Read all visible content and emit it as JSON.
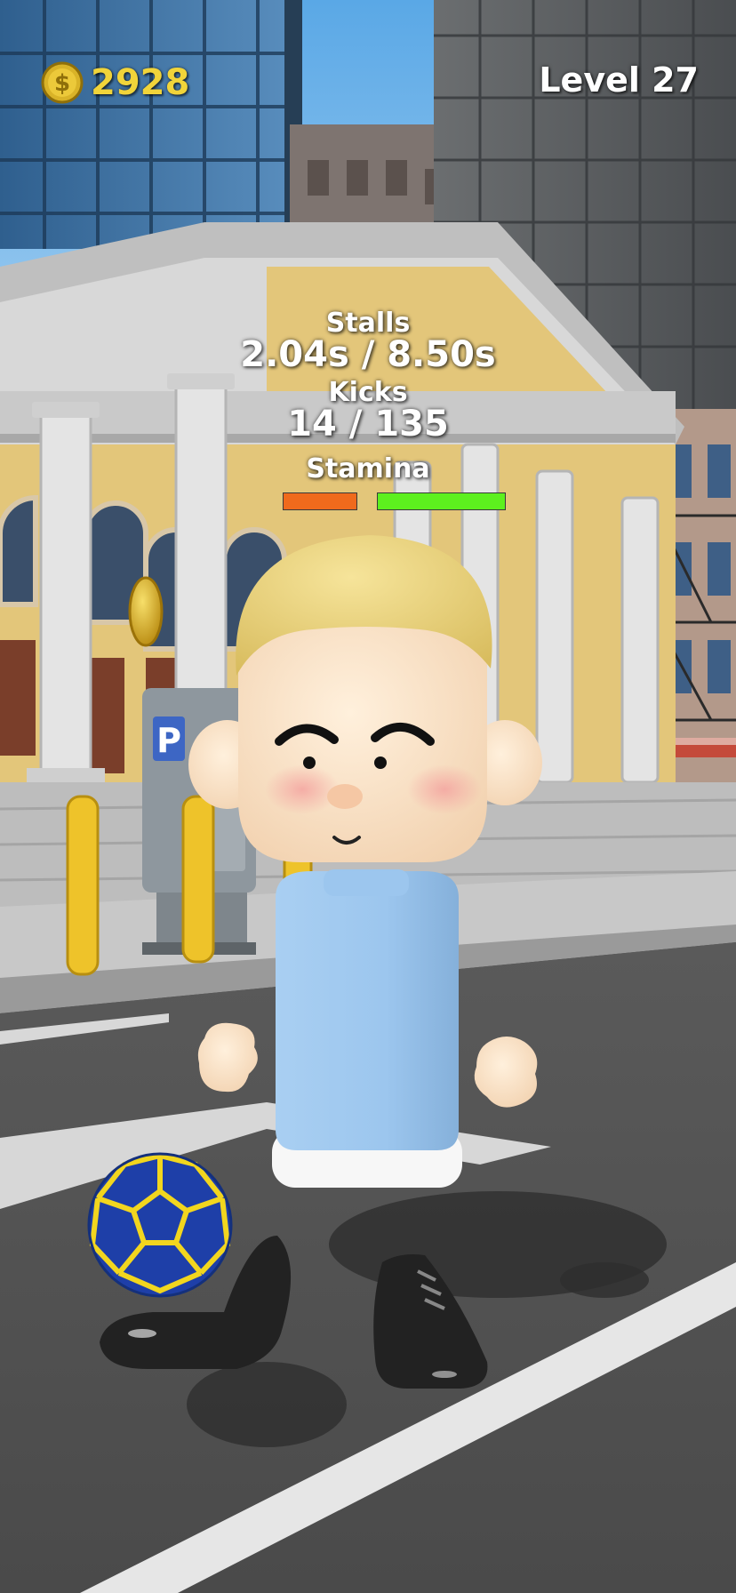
{
  "hud": {
    "coins": "2928",
    "level": "Level 27",
    "coin_icon": "dollar-coin-icon",
    "coin_color": "#f1d43a"
  },
  "stats": {
    "stalls_label": "Stalls",
    "stalls_value": "2.04s / 8.50s",
    "kicks_label": "Kicks",
    "kicks_value": "14 / 135",
    "stamina_label": "Stamina",
    "stamina_fraction": 0.29,
    "stamina_low_color": "#f06a1c",
    "stamina_high_color": "#5df01e"
  },
  "scene": {
    "parking_sign": "P",
    "ball_color": "#1e3fa8",
    "shirt_color": "#9cc6ee",
    "hair_color": "#ecd47a"
  }
}
